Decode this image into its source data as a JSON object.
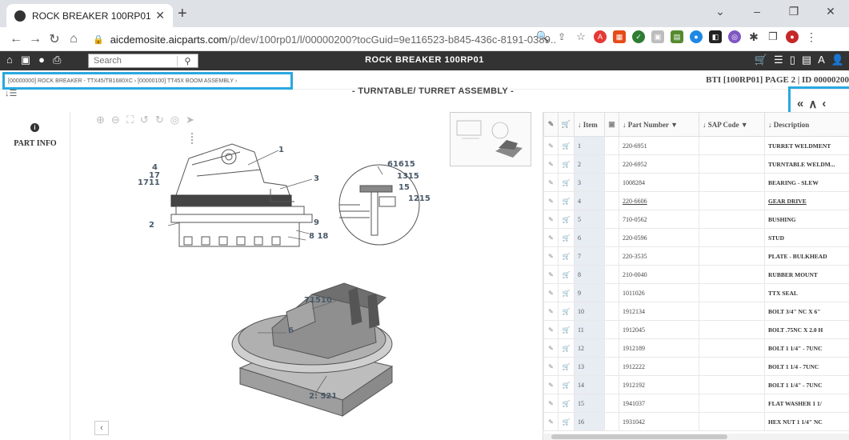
{
  "browser": {
    "tab_title": "ROCK BREAKER 100RP01",
    "url_host": "aicdemosite.aicparts.com",
    "url_path": "/p/dev/100rp01/l/00000200?tocGuid=9e116523-b845-436c-8191-0389..."
  },
  "app": {
    "search_placeholder": "Search",
    "title": "ROCK BREAKER 100RP01"
  },
  "breadcrumb": "[00000000] ROCK BREAKER - TTX45/TB1680XC  ›  [00000100] TT45X BOOM ASSEMBLY  ›",
  "page_info": "BTI [100RP01]   PAGE 2 | ID 00000200",
  "section_title": "- TURNTABLE/ TURRET ASSEMBLY -",
  "left_panel": {
    "label": "PART INFO"
  },
  "callouts": [
    "1",
    "3",
    "4",
    "17",
    "1711",
    "2",
    "9",
    "8 18",
    "61615",
    "1315",
    "15",
    "1215",
    "71510",
    "6",
    "2: 521"
  ],
  "table": {
    "headers": {
      "item": "Item",
      "part_number": "Part Number",
      "sap_code": "SAP Code",
      "description": "Description"
    },
    "rows": [
      {
        "item": "1",
        "part": "220-6951",
        "desc": "TURRET WELDMENT"
      },
      {
        "item": "2",
        "part": "220-6952",
        "desc": "TURNTABLE WELDM..."
      },
      {
        "item": "3",
        "part": "1008284",
        "desc": "BEARING - SLEW"
      },
      {
        "item": "4",
        "part": "220-6606",
        "desc": "GEAR DRIVE"
      },
      {
        "item": "5",
        "part": "710-0562",
        "desc": "BUSHING"
      },
      {
        "item": "6",
        "part": "220-0596",
        "desc": "STUD"
      },
      {
        "item": "7",
        "part": "220-3535",
        "desc": "PLATE - BULKHEAD"
      },
      {
        "item": "8",
        "part": "210-0040",
        "desc": "RUBBER MOUNT"
      },
      {
        "item": "9",
        "part": "1011026",
        "desc": "TTX SEAL"
      },
      {
        "item": "10",
        "part": "1912134",
        "desc": "BOLT 3/4\" NC X 6\""
      },
      {
        "item": "11",
        "part": "1912045",
        "desc": "BOLT .75NC X 2.0 H"
      },
      {
        "item": "12",
        "part": "1912189",
        "desc": "BOLT 1 1/4\" - 7UNC"
      },
      {
        "item": "13",
        "part": "1912222",
        "desc": "BOLT 1 1/4 - 7UNC"
      },
      {
        "item": "14",
        "part": "1912192",
        "desc": "BOLT 1 1/4\" - 7UNC"
      },
      {
        "item": "15",
        "part": "1941037",
        "desc": "FLAT WASHER 1 1/"
      },
      {
        "item": "16",
        "part": "1931042",
        "desc": "HEX NUT 1 1/4\" NC"
      }
    ]
  }
}
